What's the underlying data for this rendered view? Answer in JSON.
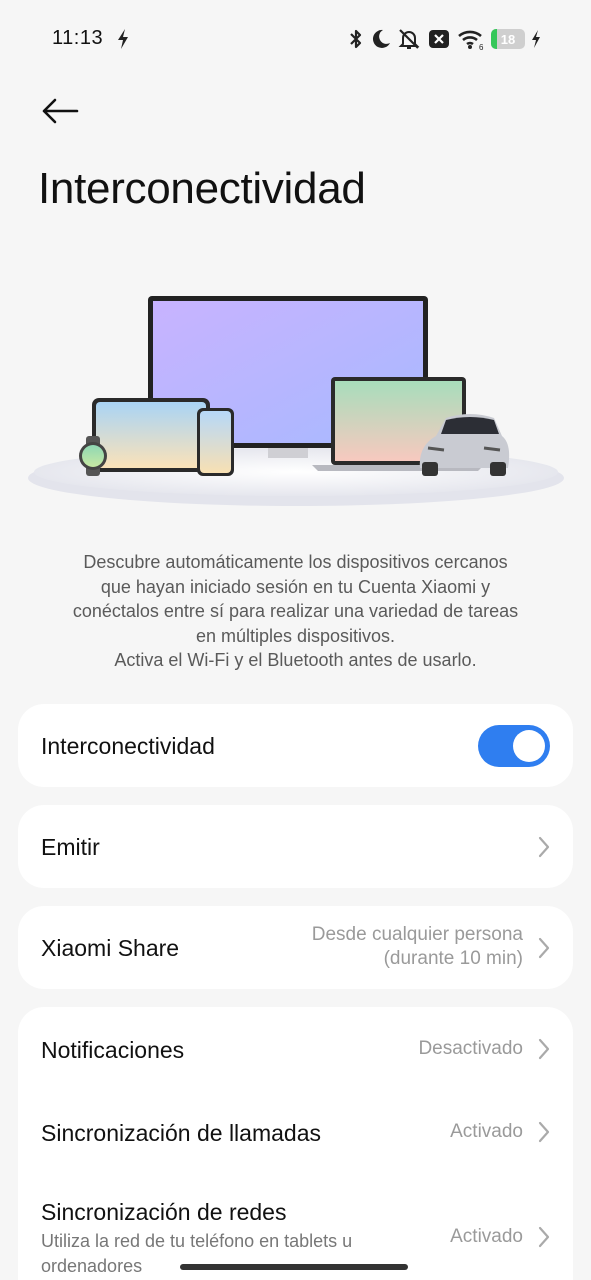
{
  "status_bar": {
    "time": "11:13",
    "battery_level": "18",
    "battery_fraction": 0.18,
    "icons": [
      "lightning-icon",
      "bluetooth-icon",
      "moon-icon",
      "bell-off-icon",
      "close-box-icon",
      "wifi-icon",
      "battery-icon",
      "charging-icon"
    ]
  },
  "header": {
    "title": "Interconectividad"
  },
  "description": {
    "lines": [
      "Descubre automáticamente los dispositivos cercanos",
      "que hayan iniciado sesión en tu Cuenta Xiaomi y",
      "conéctalos entre sí para realizar una variedad de tareas",
      "en múltiples dispositivos.",
      "Activa el Wi-Fi y el Bluetooth antes de usarlo."
    ]
  },
  "settings": {
    "interconnectivity": {
      "label": "Interconectividad",
      "enabled": true
    },
    "cast": {
      "label": "Emitir"
    },
    "xiaomi_share": {
      "label": "Xiaomi Share",
      "value_line1": "Desde cualquier persona",
      "value_line2": "(durante 10 min)"
    },
    "notifications": {
      "label": "Notificaciones",
      "value": "Desactivado"
    },
    "call_sync": {
      "label": "Sincronización de llamadas",
      "value": "Activado"
    },
    "network_sync": {
      "label": "Sincronización de redes",
      "sub_line1": "Utiliza la red de tu teléfono en tablets u",
      "sub_line2": "ordenadores",
      "value": "Activado"
    }
  },
  "colors": {
    "accent": "#2f7ef0",
    "background": "#f6f6f6",
    "card": "#ffffff",
    "battery_green": "#35c759"
  }
}
